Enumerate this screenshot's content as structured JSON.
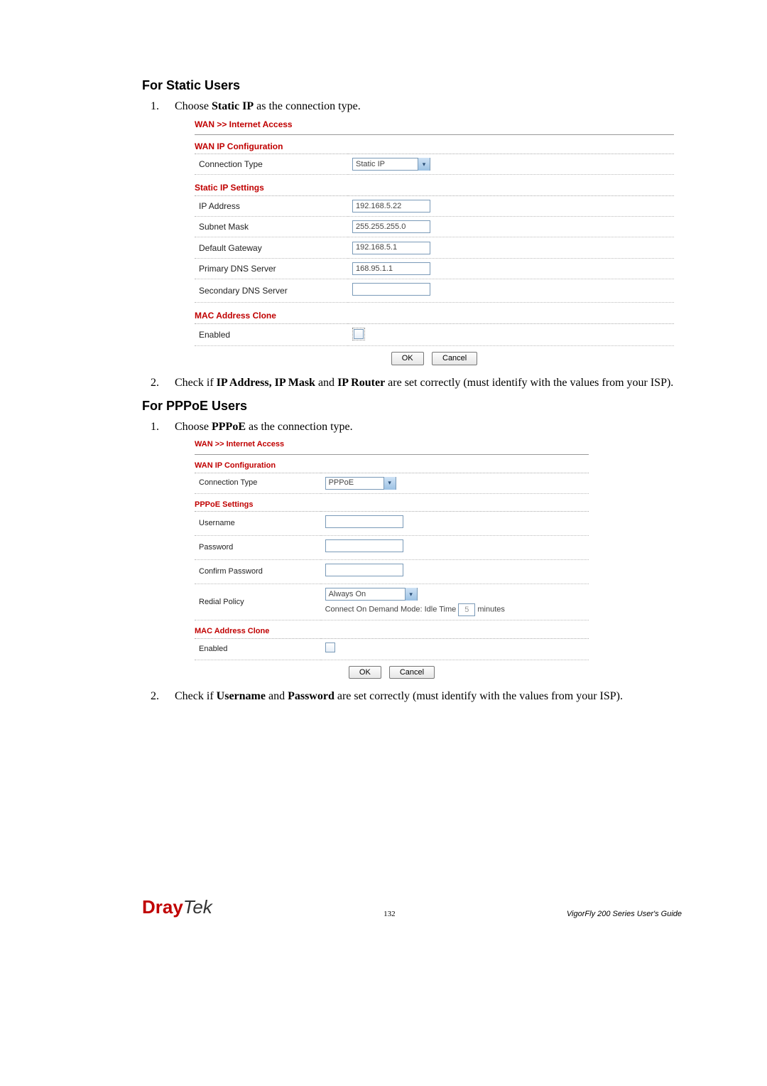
{
  "section1": {
    "title": "For Static Users",
    "step1_pre": "Choose ",
    "step1_bold": "Static IP",
    "step1_post": " as the connection type.",
    "step2_pre": "Check if ",
    "step2_b1": "IP Address, IP Mask",
    "step2_mid": " and ",
    "step2_b2": "IP Router",
    "step2_post": " are set correctly (must identify with the values from your ISP)."
  },
  "panel1": {
    "breadcrumb": "WAN >> Internet Access",
    "wanip_title": "WAN IP Configuration",
    "conn_type_label": "Connection Type",
    "conn_type_value": "Static IP",
    "static_title": "Static IP Settings",
    "rows": {
      "ip_label": "IP Address",
      "ip_val": "192.168.5.22",
      "mask_label": "Subnet Mask",
      "mask_val": "255.255.255.0",
      "gw_label": "Default Gateway",
      "gw_val": "192.168.5.1",
      "dns1_label": "Primary DNS Server",
      "dns1_val": "168.95.1.1",
      "dns2_label": "Secondary DNS Server",
      "dns2_val": ""
    },
    "mac_title": "MAC Address Clone",
    "enabled_label": "Enabled",
    "ok": "OK",
    "cancel": "Cancel"
  },
  "section2": {
    "title": "For PPPoE Users",
    "step1_pre": "Choose ",
    "step1_bold": "PPPoE",
    "step1_post": " as the connection type.",
    "step2_pre": "Check if ",
    "step2_b1": "Username",
    "step2_mid": " and ",
    "step2_b2": "Password",
    "step2_post": " are set correctly (must identify with the values from your ISP)."
  },
  "panel2": {
    "breadcrumb": "WAN >> Internet Access",
    "wanip_title": "WAN IP Configuration",
    "conn_type_label": "Connection Type",
    "conn_type_value": "PPPoE",
    "pppoe_title": "PPPoE Settings",
    "user_label": "Username",
    "pass_label": "Password",
    "conf_label": "Confirm Password",
    "redial_label": "Redial Policy",
    "redial_value": "Always On",
    "idle_pre": "Connect On Demand Mode: Idle Time ",
    "idle_val": "5",
    "idle_post": "  minutes",
    "mac_title": "MAC Address Clone",
    "enabled_label": "Enabled",
    "ok": "OK",
    "cancel": "Cancel"
  },
  "footer": {
    "logo1": "Dray",
    "logo2": "Tek",
    "page": "132",
    "guide": "VigorFly 200 Series User's Guide"
  }
}
